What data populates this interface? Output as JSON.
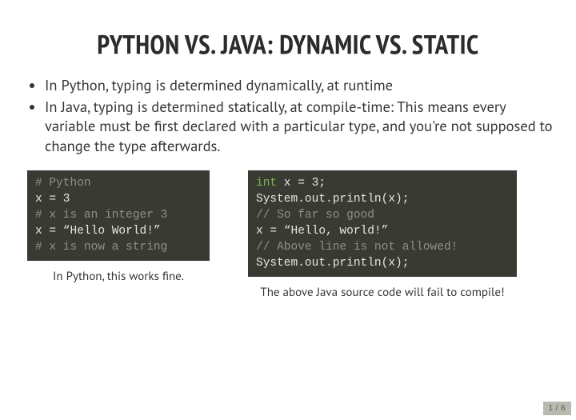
{
  "title": "PYTHON VS. JAVA: DYNAMIC VS. STATIC",
  "bullets": [
    "In Python, typing is determined dynamically, at runtime",
    "In Java, typing is determined statically, at compile-time: This means every variable must be first declared with a particular type, and you're not supposed to change the type afterwards."
  ],
  "python": {
    "lines": [
      {
        "cls": "cm",
        "text": "# Python"
      },
      {
        "cls": "tx",
        "text": "x = 3"
      },
      {
        "cls": "cm",
        "text": "# x is an integer 3"
      },
      {
        "cls": "tx",
        "text": "x = “Hello World!”"
      },
      {
        "cls": "cm",
        "text": "# x is now a string"
      }
    ],
    "caption": "In Python, this works fine."
  },
  "java": {
    "lines": [
      {
        "parts": [
          {
            "cls": "kw",
            "text": "int"
          },
          {
            "cls": "tx",
            "text": " x = 3;"
          }
        ]
      },
      {
        "cls": "tx",
        "text": "System.out.println(x);"
      },
      {
        "cls": "cm",
        "text": "// So far so good"
      },
      {
        "cls": "tx",
        "text": "x = “Hello, world!”"
      },
      {
        "cls": "cm",
        "text": "// Above line is not allowed!"
      },
      {
        "cls": "tx",
        "text": "System.out.println(x);"
      }
    ],
    "caption": "The above Java source code will fail to compile!"
  },
  "pager": {
    "current": "1",
    "sep": "/",
    "total": "6"
  }
}
